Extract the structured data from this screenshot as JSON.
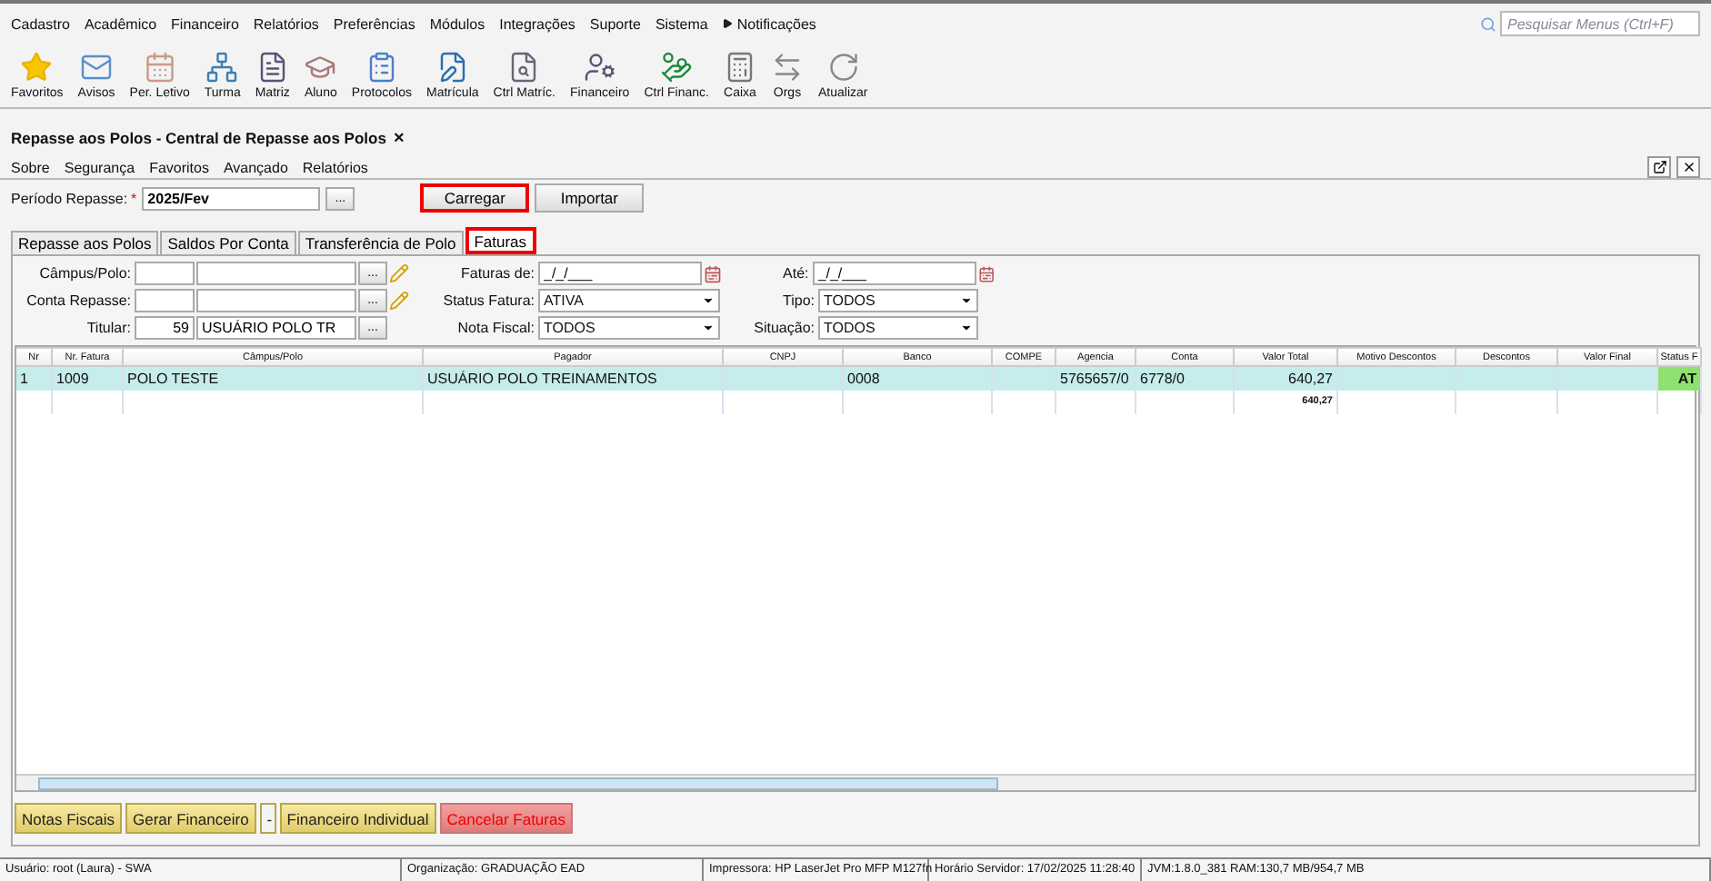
{
  "menu": [
    "Cadastro",
    "Acadêmico",
    "Financeiro",
    "Relatórios",
    "Preferências",
    "Módulos",
    "Integrações",
    "Suporte",
    "Sistema",
    "Notificações"
  ],
  "search": {
    "placeholder": "Pesquisar Menus (Ctrl+F)"
  },
  "toolbar": [
    {
      "label": "Favoritos",
      "kind": "star"
    },
    {
      "label": "Avisos",
      "kind": "mail"
    },
    {
      "label": "Per. Letivo",
      "kind": "calendar"
    },
    {
      "label": "Turma",
      "kind": "group"
    },
    {
      "label": "Matriz",
      "kind": "doc"
    },
    {
      "label": "Aluno",
      "kind": "student"
    },
    {
      "label": "Protocolos",
      "kind": "clip"
    },
    {
      "label": "Matrícula",
      "kind": "edit"
    },
    {
      "label": "Ctrl Matríc.",
      "kind": "searchdoc"
    },
    {
      "label": "Financeiro",
      "kind": "person"
    },
    {
      "label": "Ctrl Financ.",
      "kind": "money"
    },
    {
      "label": "Caixa",
      "kind": "register"
    },
    {
      "label": "Orgs",
      "kind": "arrows"
    },
    {
      "label": "Atualizar",
      "kind": "refresh"
    }
  ],
  "window_tab": {
    "title": "Repasse aos Polos - Central de Repasse aos Polos",
    "close": "×"
  },
  "submenu": [
    "Sobre",
    "Segurança",
    "Favoritos",
    "Avançado",
    "Relatórios"
  ],
  "period": {
    "label": "Período Repasse:",
    "required": "*",
    "value": "2025/Fev",
    "browse": "..."
  },
  "actions": [
    {
      "label": "Carregar",
      "highlighted": true
    },
    {
      "label": "Importar",
      "highlighted": false
    }
  ],
  "tabs": [
    {
      "label": "Repasse aos Polos",
      "selected": false,
      "highlighted": false
    },
    {
      "label": "Saldos Por Conta",
      "selected": false,
      "highlighted": false
    },
    {
      "label": "Transferência de Polo",
      "selected": false,
      "highlighted": false
    },
    {
      "label": "Faturas",
      "selected": true,
      "highlighted": true
    }
  ],
  "filters": [
    [
      {
        "kind": "lookup",
        "label": "Câmpus/Polo:",
        "browse": "...",
        "edit": true
      },
      {
        "kind": "date",
        "label": "Faturas de:",
        "value": "_/_/___"
      },
      {
        "kind": "date",
        "label": "Até:",
        "value": "_/_/___"
      }
    ],
    [
      {
        "kind": "lookup",
        "label": "Conta Repasse:",
        "browse": "...",
        "edit": true
      },
      {
        "kind": "select",
        "label": "Status Fatura:",
        "value": "ATIVA"
      },
      {
        "kind": "select",
        "label": "Tipo:",
        "value": "TODOS"
      }
    ],
    [
      {
        "kind": "lookup",
        "label": "Titular:",
        "code": "59",
        "name": "USUÁRIO POLO TR",
        "browse": "...",
        "edit": false
      },
      {
        "kind": "select",
        "label": "Nota Fiscal:",
        "value": "TODOS"
      },
      {
        "kind": "select",
        "label": "Situação:",
        "value": "TODOS"
      }
    ]
  ],
  "table": {
    "columns": [
      "Nr",
      "Nr. Fatura",
      "Câmpus/Polo",
      "Pagador",
      "CNPJ",
      "Banco",
      "COMPE",
      "Agencia",
      "Conta",
      "Valor Total",
      "Motivo Descontos",
      "Descontos",
      "Valor Final",
      "Status F"
    ],
    "rows": [
      {
        "selected": true,
        "cells": [
          "1",
          "1009",
          "POLO TESTE",
          "USUÁRIO POLO TREINAMENTOS",
          "",
          "0008",
          "",
          "5765657/0",
          "6778/0",
          "640,27",
          "",
          "",
          "",
          "AT"
        ]
      }
    ],
    "totals": {
      "Valor Total": "640,27"
    }
  },
  "buttons": [
    {
      "label": "Notas Fiscais",
      "kind": "normal"
    },
    {
      "label": "Gerar Financeiro",
      "kind": "normal"
    },
    {
      "label": "-",
      "kind": "small"
    },
    {
      "label": "Financeiro Individual",
      "kind": "normal"
    },
    {
      "label": "Cancelar Faturas",
      "kind": "danger"
    }
  ],
  "status_bar": [
    "Usuário: root (Laura) - SWA",
    "Organização: GRADUAÇÃO EAD",
    "Impressora: HP LaserJet Pro MFP M127fn",
    "Horário Servidor: 17/02/2025 11:28:40",
    "JVM:1.8.0_381  RAM:130,7 MB/954,7 MB"
  ]
}
